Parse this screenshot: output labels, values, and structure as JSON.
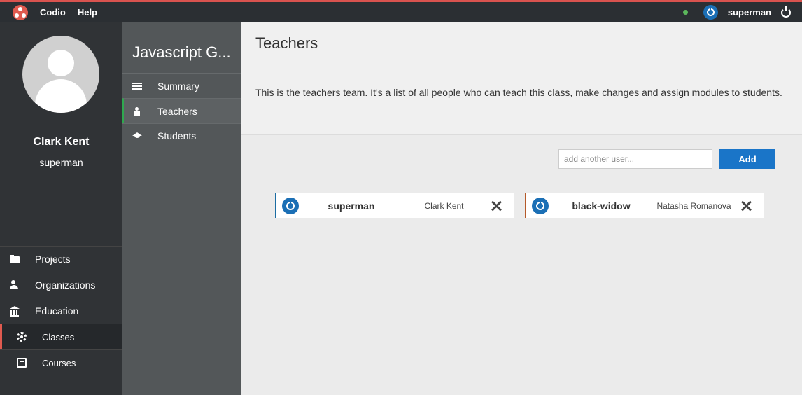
{
  "topbar": {
    "menu": [
      "Codio",
      "Help"
    ],
    "username": "superman",
    "status_color": "#5cb85c",
    "accent": "#e05a4f",
    "icons": [
      "codio-logo-icon",
      "online-status-icon",
      "user-power-icon",
      "logout-icon"
    ]
  },
  "profile": {
    "name": "Clark Kent",
    "username": "superman"
  },
  "sidebar": {
    "items": [
      {
        "label": "Projects",
        "icon": "folder-icon"
      },
      {
        "label": "Organizations",
        "icon": "organizations-icon"
      },
      {
        "label": "Education",
        "icon": "education-icon"
      },
      {
        "label": "Classes",
        "icon": "gear-icon",
        "active": true
      },
      {
        "label": "Courses",
        "icon": "courses-icon"
      }
    ]
  },
  "panel": {
    "title": "Javascript G...",
    "items": [
      {
        "label": "Summary",
        "icon": "list-icon"
      },
      {
        "label": "Teachers",
        "icon": "teacher-icon",
        "active": true
      },
      {
        "label": "Students",
        "icon": "student-cap-icon"
      }
    ]
  },
  "main": {
    "title": "Teachers",
    "description": "This is the teachers team. It's a list of all people who can teach this class, make changes and assign modules to students.",
    "add_placeholder": "add another user...",
    "add_value": "",
    "add_button": "Add",
    "teachers": [
      {
        "username": "superman",
        "fullname": "Clark Kent",
        "accent": "#1c6da3"
      },
      {
        "username": "black-widow",
        "fullname": "Natasha Romanova",
        "accent": "#b55a2a"
      }
    ]
  }
}
